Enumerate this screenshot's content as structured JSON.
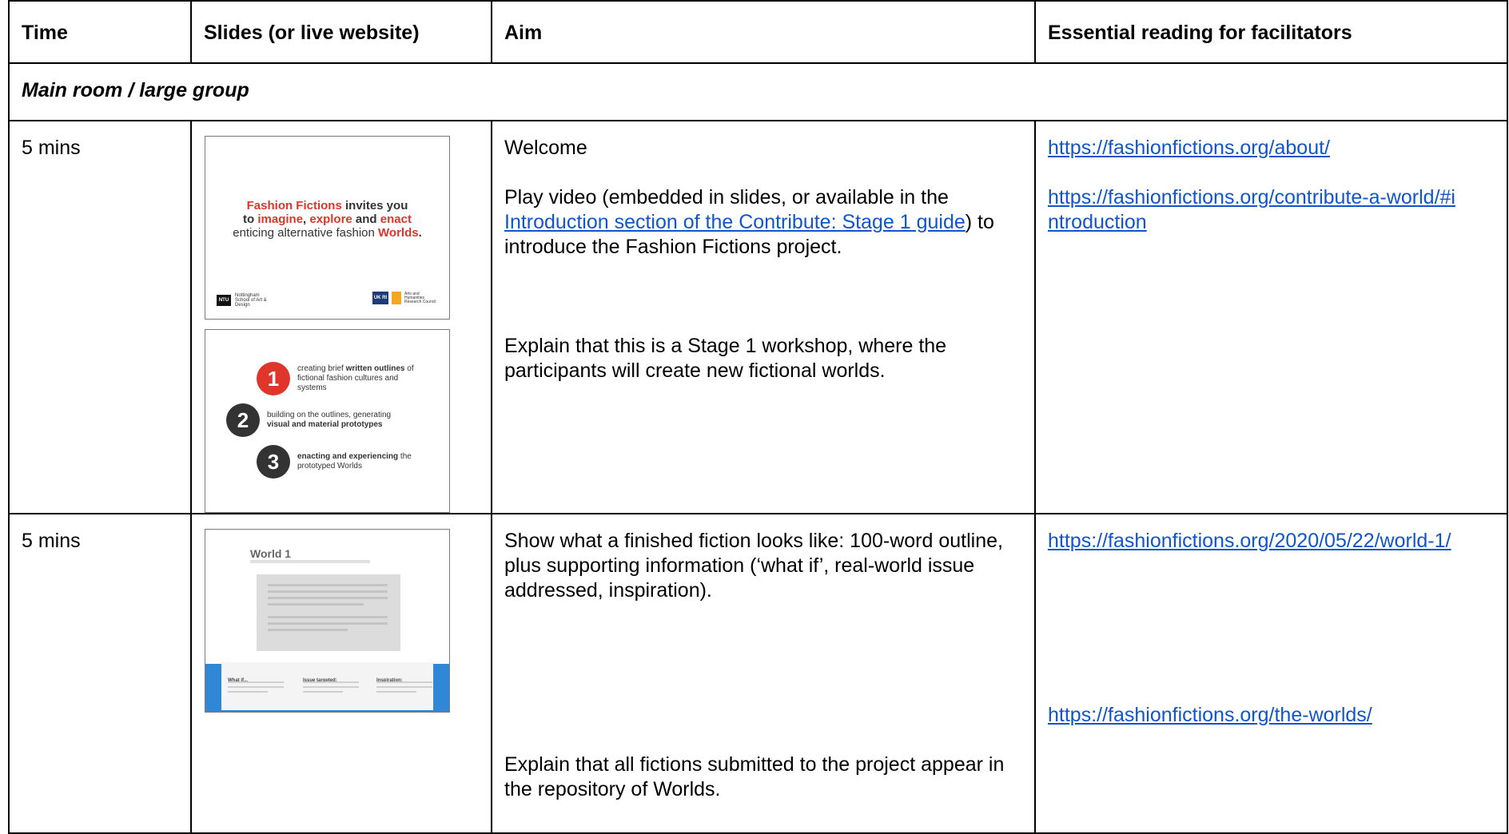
{
  "headers": {
    "time": "Time",
    "slides": "Slides (or live website)",
    "aim": "Aim",
    "reading": "Essential reading for facilitators"
  },
  "section_label": "Main room / large group",
  "rows": [
    {
      "time": "5 mins",
      "aim": {
        "p1": "Welcome",
        "p2_before": "Play video (embedded in slides, or available in the ",
        "p2_link": "Introduction section of the Contribute: Stage 1 guide",
        "p2_after": ") to introduce the Fashion Fictions project.",
        "p3": "Explain that this is a Stage 1 workshop, where the participants will create new fictional worlds."
      },
      "links": [
        "https://fashionfictions.org/about/",
        "https://fashionfictions.org/contribute-a-world/#introduction"
      ]
    },
    {
      "time": "5 mins",
      "aim": {
        "p1": "Show what a finished fiction looks like: 100-word outline, plus supporting information (‘what if’, real-world issue addressed, inspiration).",
        "p2": "Explain that all fictions submitted to the project appear in the repository of Worlds."
      },
      "links": [
        "https://fashionfictions.org/2020/05/22/world-1/",
        "https://fashionfictions.org/the-worlds/"
      ]
    }
  ],
  "slide1": {
    "brand": "Fashion Fictions",
    "l1_rest": " invites you",
    "l2_to": "to ",
    "l2_imagine": "imagine",
    "l2_comma": ", ",
    "l2_explore": "explore",
    "l2_and": " and ",
    "l2_enact": "enact",
    "l3_pre": "enticing alternative fashion ",
    "l3_worlds": "Worlds",
    "l3_dot": ".",
    "ntu_badge": "NTU",
    "ntu_text": "Nottingham School of Art & Design",
    "ukri_badge": "UK RI",
    "ukri_text": "Arts and Humanities Research Council",
    "colors": {
      "brand_red": "#d9372b",
      "ntu": "#111111",
      "ukri_blue": "#1f3a78",
      "ukri_orange": "#f5a623"
    }
  },
  "slide2": {
    "steps": [
      {
        "num": "1",
        "text_pre": "creating brief ",
        "text_bold": "written outlines",
        "text_post": " of fictional fashion cultures and systems",
        "color": "#e0352b"
      },
      {
        "num": "2",
        "text_pre": "building on the outlines, generating ",
        "text_bold": "visual and material prototypes",
        "text_post": "",
        "color": "#333333"
      },
      {
        "num": "3",
        "text_pre": "",
        "text_bold": "enacting and experiencing",
        "text_post": " the prototyped Worlds",
        "color": "#333333"
      }
    ]
  },
  "slide3": {
    "title": "World 1",
    "cols": [
      "What if...",
      "Issue targeted:",
      "Inspiration:"
    ],
    "colors": {
      "band": "#2f87d5"
    }
  }
}
